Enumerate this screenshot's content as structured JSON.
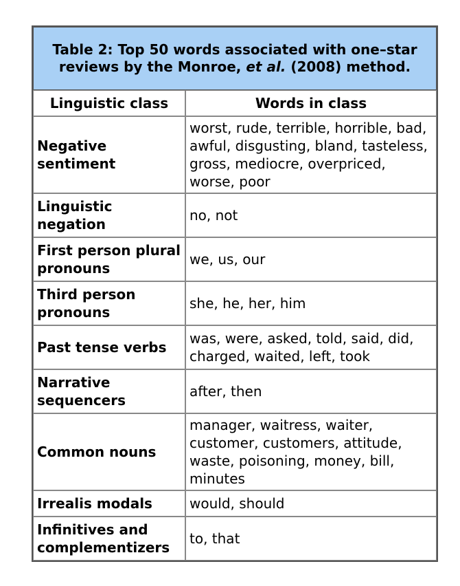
{
  "caption": {
    "prefix": "Table 2: Top 50 words associated with one–star reviews by the Monroe, ",
    "italic": "et al.",
    "suffix": " (2008) method."
  },
  "headers": [
    "Linguistic class",
    "Words in class"
  ],
  "rows": [
    {
      "class": "Negative sentiment",
      "words": "worst, rude, terrible, horrible, bad, awful, disgusting, bland, tasteless, gross, mediocre, overpriced, worse, poor"
    },
    {
      "class": "Linguistic negation",
      "words": "no, not"
    },
    {
      "class": "First person plural pronouns",
      "words": "we, us, our"
    },
    {
      "class": "Third person pronouns",
      "words": "she, he, her, him"
    },
    {
      "class": "Past tense verbs",
      "words": "was, were, asked, told, said, did, charged, waited, left, took"
    },
    {
      "class": "Narrative sequencers",
      "words": "after, then"
    },
    {
      "class": "Common nouns",
      "words": "manager, waitress, waiter, customer, customers, attitude, waste, poisoning, money, bill, minutes"
    },
    {
      "class": "Irrealis modals",
      "words": "would, should"
    },
    {
      "class": "Infinitives and complementizers",
      "words": "to, that"
    }
  ]
}
